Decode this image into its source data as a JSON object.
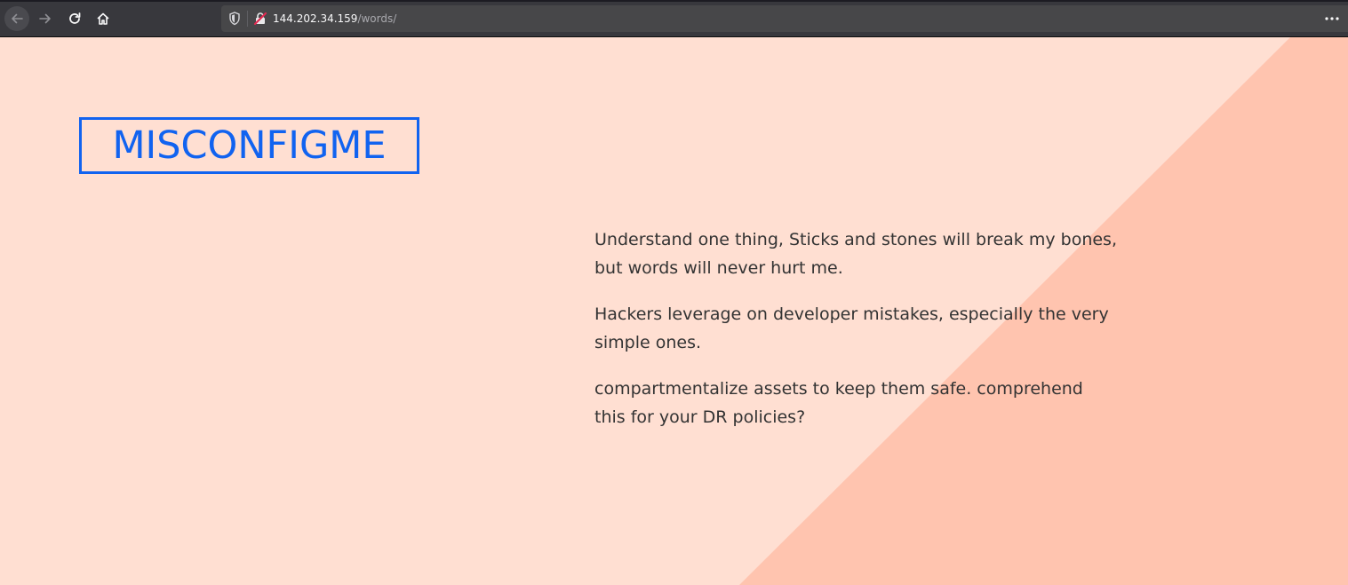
{
  "browser": {
    "url_host": "144.202.34.159",
    "url_path": "/words/",
    "icons": {
      "back": "back-arrow-icon",
      "forward": "forward-arrow-icon",
      "reload": "reload-icon",
      "home": "home-icon",
      "tracking": "shield-icon",
      "security": "insecure-lock-icon",
      "menu": "more-dots-icon"
    }
  },
  "page": {
    "logo": "MISCONFIGME",
    "paragraphs": [
      "Understand one thing, Sticks and stones will break my bones, but words will never hurt me.",
      "Hackers leverage on developer mistakes, especially the very simple ones.",
      "compartmentalize assets to keep them safe. comprehend this for your DR policies?"
    ]
  },
  "colors": {
    "background": "#ffdfd2",
    "accent_triangle": "#ffc4af",
    "logo_blue": "#1163f0",
    "text": "#333333",
    "toolbar": "#38383d",
    "urlbar": "#474749"
  }
}
